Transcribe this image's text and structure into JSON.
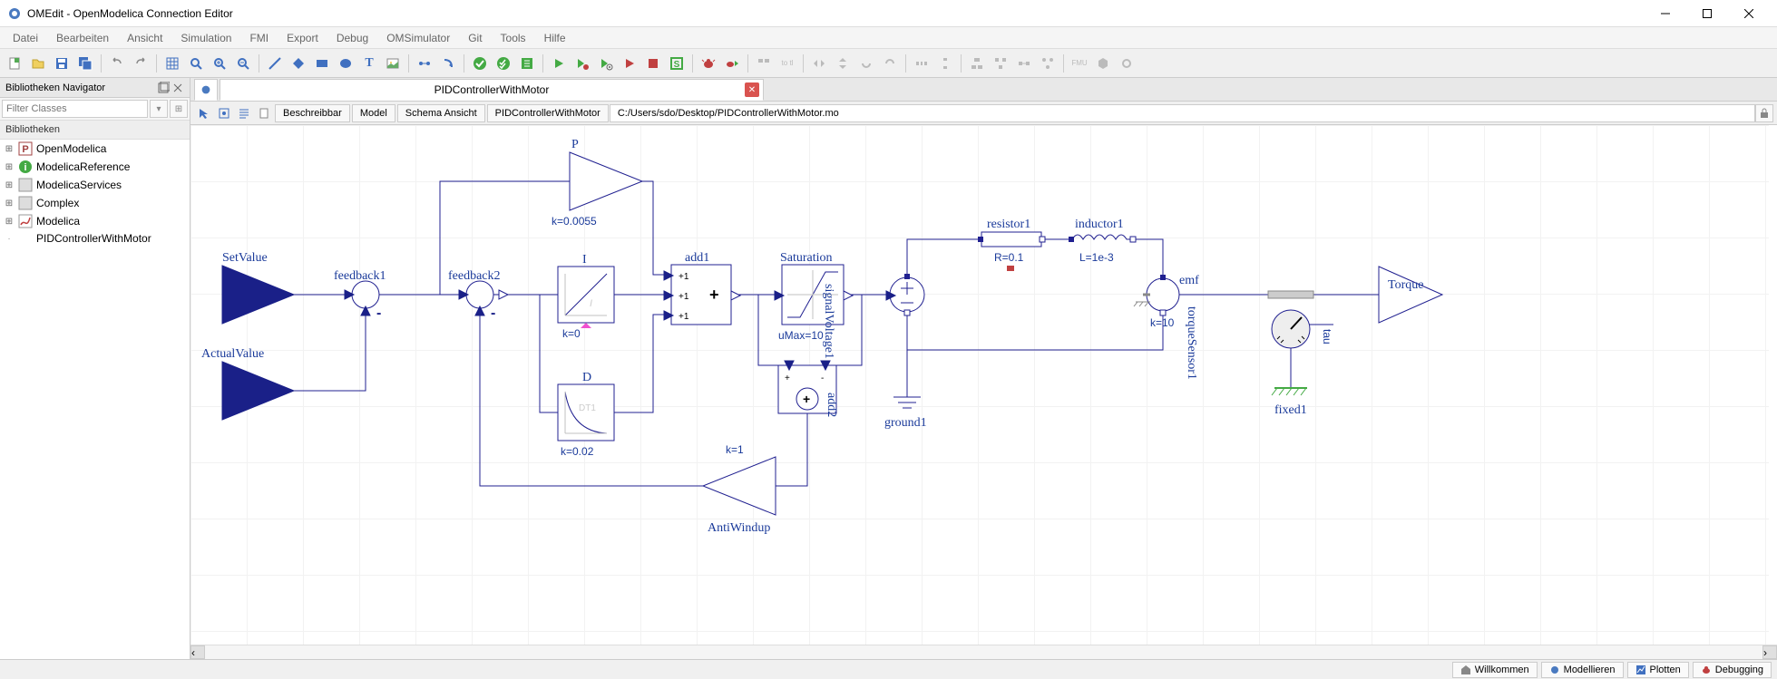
{
  "window": {
    "title": "OMEdit - OpenModelica Connection Editor"
  },
  "menu": [
    "Datei",
    "Bearbeiten",
    "Ansicht",
    "Simulation",
    "FMI",
    "Export",
    "Debug",
    "OMSimulator",
    "Git",
    "Tools",
    "Hilfe"
  ],
  "sidebar": {
    "panel_title": "Bibliotheken Navigator",
    "filter_placeholder": "Filter Classes",
    "lib_header": "Bibliotheken",
    "items": [
      {
        "label": "OpenModelica",
        "expandable": true
      },
      {
        "label": "ModelicaReference",
        "expandable": true
      },
      {
        "label": "ModelicaServices",
        "expandable": true
      },
      {
        "label": "Complex",
        "expandable": true
      },
      {
        "label": "Modelica",
        "expandable": true
      },
      {
        "label": "PIDControllerWithMotor",
        "expandable": false
      }
    ]
  },
  "tabs": {
    "active": "PIDControllerWithMotor"
  },
  "subbar": {
    "writable": "Beschreibbar",
    "model": "Model",
    "view": "Schema Ansicht",
    "name": "PIDControllerWithMotor",
    "path": "C:/Users/sdo/Desktop/PIDControllerWithMotor.mo"
  },
  "diagram": {
    "SetValue": "SetValue",
    "ActualValue": "ActualValue",
    "feedback1": "feedback1",
    "feedback2": "feedback2",
    "P": "P",
    "P_k": "k=0.0055",
    "I": "I",
    "I_k": "k=0",
    "D": "D",
    "D_k": "k=0.02",
    "D_inner": "DT1",
    "add1": "add1",
    "add1_g1": "+1",
    "add1_g2": "+1",
    "add1_g3": "+1",
    "Saturation": "Saturation",
    "Saturation_p": "uMax=10",
    "add2": "add2",
    "AntiWindup": "AntiWindup",
    "AntiWindup_k": "k=1",
    "signalVoltage1": "signalVoltage1",
    "ground1": "ground1",
    "resistor1": "resistor1",
    "resistor1_p": "R=0.1",
    "inductor1": "inductor1",
    "inductor1_p": "L=1e-3",
    "emf": "emf",
    "emf_k": "k=10",
    "torqueSensor1": "torqueSensor1",
    "tau": "tau",
    "fixed1": "fixed1",
    "Torque": "Torque"
  },
  "status": {
    "welcome": "Willkommen",
    "model": "Modellieren",
    "plot": "Plotten",
    "debug": "Debugging"
  }
}
